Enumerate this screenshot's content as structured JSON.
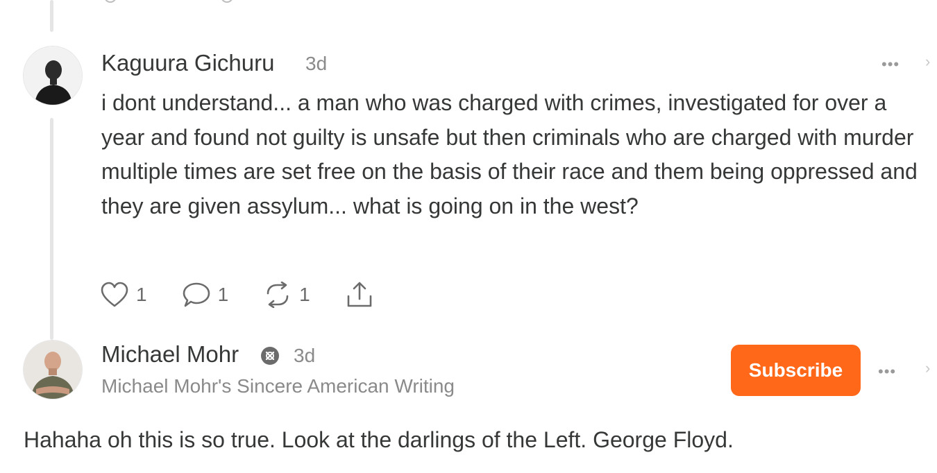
{
  "comments": [
    {
      "author": "Kaguura Gichuru",
      "time": "3d",
      "body": "i dont understand... a man who was charged with crimes, investigated for over a year and found not guilty is unsafe but then criminals who are charged with murder multiple times are set free on the basis of their race and them being oppressed and they are given assylum... what is going on in the west?",
      "actions": {
        "like_icon": "heart-icon",
        "like_count": "1",
        "comment_icon": "comment-bubble-icon",
        "comment_count": "1",
        "restack_icon": "restack-icon",
        "restack_count": "1",
        "share_icon": "share-icon"
      },
      "more_label": "•••"
    },
    {
      "author": "Michael Mohr",
      "badge_icon": "substack-badge-icon",
      "time": "3d",
      "publication": "Michael Mohr's Sincere American Writing",
      "subscribe_label": "Subscribe",
      "more_label": "•••",
      "body": "Hahaha oh this is so true. Look at the darlings of the Left. George Floyd."
    }
  ],
  "colors": {
    "accent": "#ff6719",
    "text": "#363737",
    "muted": "#8a8a8a",
    "thread_line": "#e5e5e5"
  }
}
